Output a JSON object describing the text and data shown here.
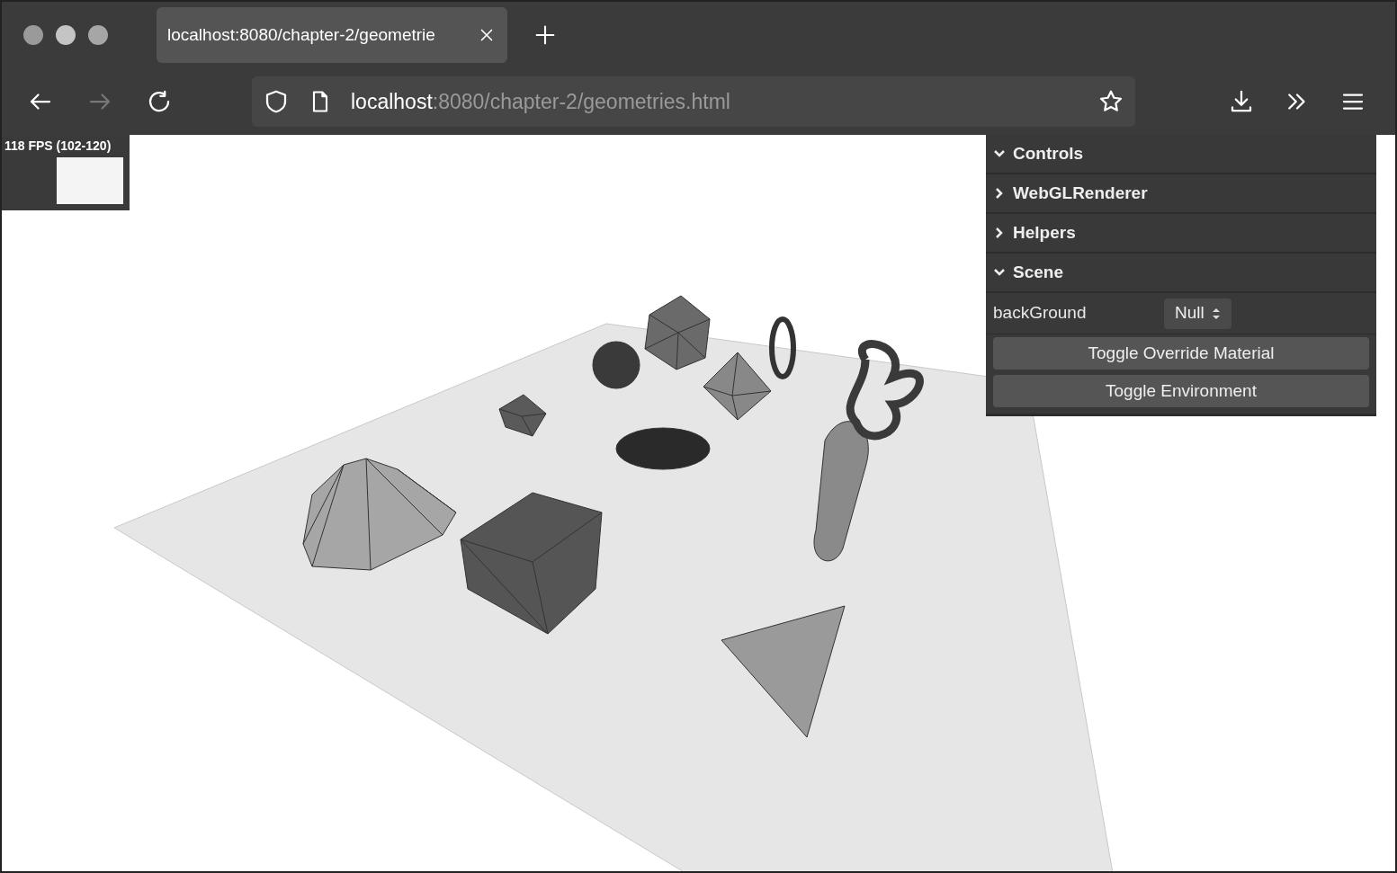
{
  "tab": {
    "title": "localhost:8080/chapter-2/geometrie",
    "selected": true
  },
  "address": {
    "host": "localhost",
    "rest": ":8080/chapter-2/geometries.html"
  },
  "stats": {
    "fps": "118 FPS (102-120)"
  },
  "panel": {
    "folders": [
      {
        "label": "Controls",
        "expanded": true
      },
      {
        "label": "WebGLRenderer",
        "expanded": false
      },
      {
        "label": "Helpers",
        "expanded": false
      },
      {
        "label": "Scene",
        "expanded": true,
        "children": [
          {
            "kind": "select",
            "label": "backGround",
            "value": "Null"
          },
          {
            "kind": "button",
            "label": "Toggle Override Material"
          },
          {
            "kind": "button",
            "label": "Toggle Environment"
          }
        ]
      }
    ]
  }
}
